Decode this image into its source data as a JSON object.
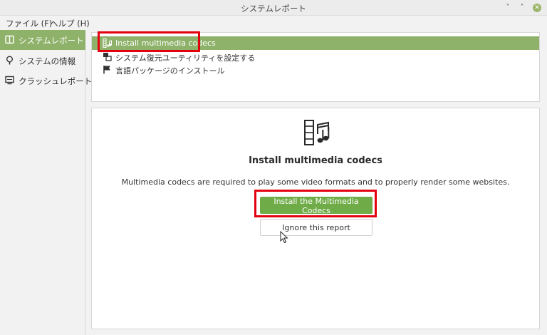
{
  "window": {
    "title": "システムレポート",
    "controls": {
      "minimize": "˅",
      "maximize": "˄",
      "close": "✕"
    }
  },
  "menubar": {
    "file": "ファイル (F)",
    "help": "ヘルプ (H)"
  },
  "sidebar": {
    "items": [
      {
        "label": "システムレポート",
        "icon": "report-icon",
        "active": true
      },
      {
        "label": "システムの情報",
        "icon": "lightbulb-icon",
        "active": false
      },
      {
        "label": "クラッシュレポート",
        "icon": "monitor-icon",
        "active": false
      }
    ]
  },
  "reports": {
    "items": [
      {
        "label": "Install multimedia codecs",
        "icon": "film-icon",
        "active": true
      },
      {
        "label": "システム復元ユーティリティを設定する",
        "icon": "restore-icon",
        "active": false
      },
      {
        "label": "言語パッケージのインストール",
        "icon": "flag-icon",
        "active": false
      }
    ]
  },
  "detail": {
    "icon": "film-music-icon",
    "title": "Install multimedia codecs",
    "description": "Multimedia codecs are required to play some video formats and to properly render some websites.",
    "primary_button": "Install the Multimedia Codecs",
    "secondary_button": "Ignore this report"
  },
  "colors": {
    "accent": "#8fb26a",
    "primary_button": "#6fac47",
    "highlight": "#e4000f"
  }
}
